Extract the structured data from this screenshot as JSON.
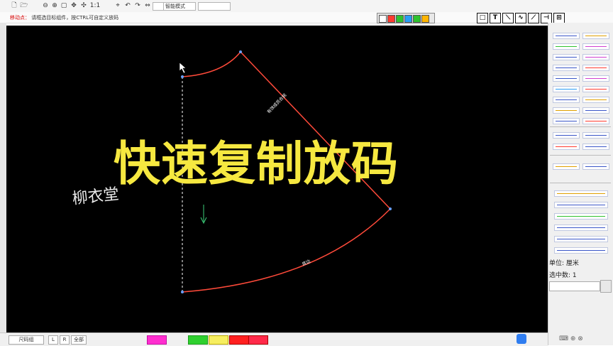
{
  "toolbar": {
    "icons": [
      "new-icon",
      "open-icon",
      "zoom-out-icon",
      "zoom-in-icon",
      "zoom-fit-icon",
      "select-icon",
      "pan-icon",
      "move-icon",
      "rotate-icon",
      "undo-icon",
      "redo-icon"
    ],
    "ratio_label": "1:1",
    "combo1": "",
    "combo2": "智能模式",
    "combo3": ""
  },
  "status": {
    "mode": "移动点：",
    "hint": "请框选目标组件，按CTRL可自定义放码"
  },
  "right_tools": [
    "□",
    "T",
    "⟍",
    "∿",
    "⟋",
    "⊣",
    "⊞"
  ],
  "overlay": {
    "title": "快速复制放码",
    "watermark": "柳衣堂"
  },
  "pattern": {
    "label_long": "有效成员合规",
    "label_bottom": "底边"
  },
  "right_panel": {
    "unit": "单位: 厘米",
    "selected": "选中数: 1"
  },
  "bottombar": {
    "size_tab": "尺码组",
    "btn_l": "L",
    "btn_r": "R",
    "btn_all": "全部"
  },
  "colors": {
    "canvas": "#000000",
    "curve": "#ff3b30",
    "overlay_text": "#f6e840",
    "accent_blue": "#3a56c8"
  }
}
